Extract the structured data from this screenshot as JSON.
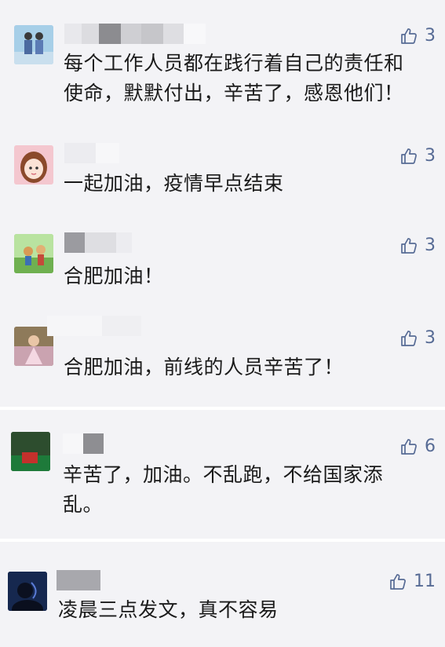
{
  "comments": [
    {
      "text": "每个工作人员都在践行着自己的责任和使命，默默付出，辛苦了，感恩他们！",
      "likes": "3"
    },
    {
      "text": "一起加油，疫情早点结束",
      "likes": "3"
    },
    {
      "text": "合肥加油！",
      "likes": "3"
    },
    {
      "text": "合肥加油，前线的人员辛苦了！",
      "likes": "3"
    },
    {
      "text": "辛苦了，加油。不乱跑，不给国家添乱。",
      "likes": "6"
    },
    {
      "text": "凌晨三点发文，真不容易",
      "likes": "11"
    }
  ],
  "icons": {
    "like": "thumbs-up-icon"
  },
  "colors": {
    "like": "#576b95",
    "text": "#1a1a1a",
    "background": "#f3f3f6"
  }
}
